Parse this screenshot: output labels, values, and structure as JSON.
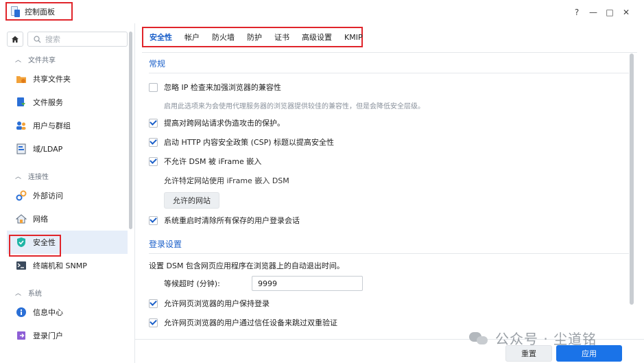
{
  "window": {
    "title": "控制面板",
    "controls": {
      "help": "?",
      "minimize": "—",
      "maximize": "□",
      "close": "✕"
    }
  },
  "sidebar": {
    "search_placeholder": "搜索",
    "groups": [
      {
        "label": "文件共享",
        "items": [
          {
            "label": "共享文件夹",
            "icon": "folder-share-icon"
          },
          {
            "label": "文件服务",
            "icon": "file-services-icon"
          },
          {
            "label": "用户与群组",
            "icon": "users-icon"
          },
          {
            "label": "域/LDAP",
            "icon": "domain-icon"
          }
        ]
      },
      {
        "label": "连接性",
        "items": [
          {
            "label": "外部访问",
            "icon": "external-access-icon"
          },
          {
            "label": "网络",
            "icon": "network-icon"
          },
          {
            "label": "安全性",
            "icon": "shield-icon",
            "active": true
          },
          {
            "label": "终端机和 SNMP",
            "icon": "terminal-icon"
          }
        ]
      },
      {
        "label": "系统",
        "items": [
          {
            "label": "信息中心",
            "icon": "info-icon"
          },
          {
            "label": "登录门户",
            "icon": "login-portal-icon"
          }
        ]
      }
    ]
  },
  "tabs": [
    "安全性",
    "帐户",
    "防火墙",
    "防护",
    "证书",
    "高级设置",
    "KMIP"
  ],
  "sections": {
    "general": {
      "title": "常规",
      "ignore_ip": "忽略 IP 检查来加强浏览器的兼容性",
      "ignore_ip_hint": "启用此选项来为会使用代理服务器的浏览器提供较佳的兼容性，但是会降低安全层级。",
      "csrf": "提高对跨网站请求伪造攻击的保护。",
      "csp": "启动 HTTP 内容安全政策 (CSP) 标题以提高安全性",
      "iframe": "不允许 DSM 被 iFrame 嵌入",
      "iframe_allow_text": "允许特定网站使用 iFrame 嵌入 DSM",
      "allowed_sites_button": "允许的网站",
      "clear_sessions": "系统重启时清除所有保存的用户登录会话"
    },
    "login": {
      "title": "登录设置",
      "desc": "设置 DSM 包含网页应用程序在浏览器上的自动退出时间。",
      "timeout_label": "等候超时 (分钟):",
      "timeout_value": "9999",
      "stay_logged_in": "允许网页浏览器的用户保持登录",
      "skip_2fa": "允许网页浏览器的用户通过信任设备来跳过双重验证"
    }
  },
  "footer": {
    "reset": "重置",
    "apply": "应用"
  },
  "watermark": "公众号 · 尘道铭",
  "colors": {
    "accent": "#1a73e8",
    "highlight_outline": "#e0242a"
  }
}
